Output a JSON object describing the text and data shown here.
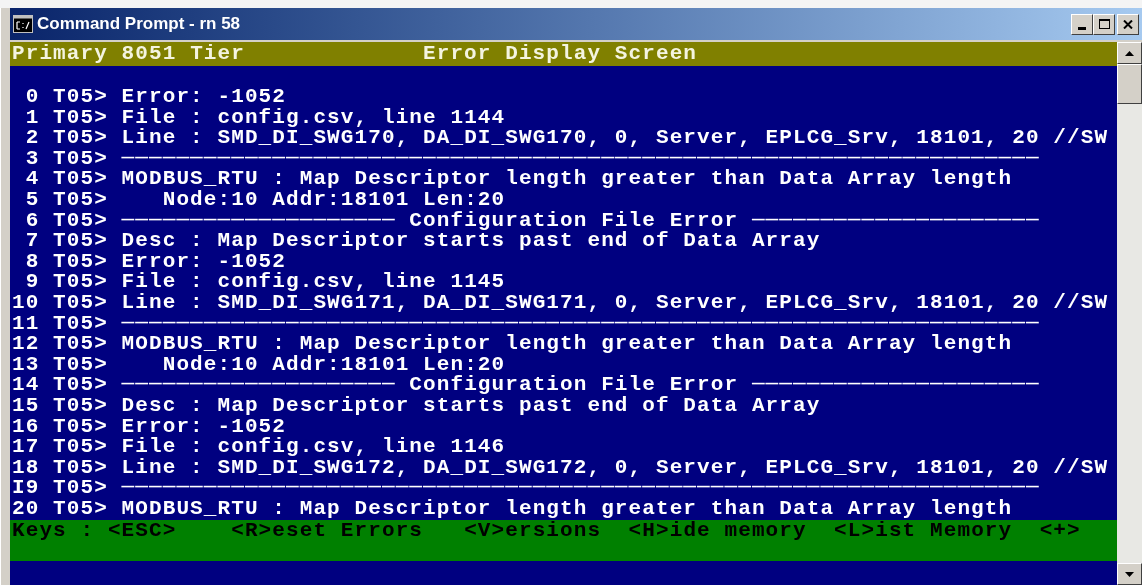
{
  "window": {
    "title": "Command Prompt - rn 58"
  },
  "header": {
    "left": "Primary 8051 Tier",
    "center": "Error Display Screen"
  },
  "lines": [
    {
      "num": "0",
      "text": "T05> Error: -1052"
    },
    {
      "num": "1",
      "text": "T05> File : config.csv, line 1144"
    },
    {
      "num": "2",
      "text": "T05> Line : SMD_DI_SWG170, DA_DI_SWG170, 0, Server, EPLCG_Srv, 18101, 20 //SW"
    },
    {
      "num": "3",
      "text": "T05> ───────────────────────────────────────────────────────────────────"
    },
    {
      "num": "4",
      "text": "T05> MODBUS_RTU : Map Descriptor length greater than Data Array length"
    },
    {
      "num": "5",
      "text": "T05>    Node:10 Addr:18101 Len:20"
    },
    {
      "num": "6",
      "text": "T05> ──────────────────── Configuration File Error ─────────────────────"
    },
    {
      "num": "7",
      "text": "T05> Desc : Map Descriptor starts past end of Data Array"
    },
    {
      "num": "8",
      "text": "T05> Error: -1052"
    },
    {
      "num": "9",
      "text": "T05> File : config.csv, line 1145"
    },
    {
      "num": "10",
      "text": "T05> Line : SMD_DI_SWG171, DA_DI_SWG171, 0, Server, EPLCG_Srv, 18101, 20 //SW"
    },
    {
      "num": "11",
      "text": "T05> ───────────────────────────────────────────────────────────────────"
    },
    {
      "num": "12",
      "text": "T05> MODBUS_RTU : Map Descriptor length greater than Data Array length"
    },
    {
      "num": "13",
      "text": "T05>    Node:10 Addr:18101 Len:20"
    },
    {
      "num": "14",
      "text": "T05> ──────────────────── Configuration File Error ─────────────────────"
    },
    {
      "num": "15",
      "text": "T05> Desc : Map Descriptor starts past end of Data Array"
    },
    {
      "num": "16",
      "text": "T05> Error: -1052"
    },
    {
      "num": "17",
      "text": "T05> File : config.csv, line 1146"
    },
    {
      "num": "18",
      "text": "T05> Line : SMD_DI_SWG172, DA_DI_SWG172, 0, Server, EPLCG_Srv, 18101, 20 //SW"
    },
    {
      "num": "I9",
      "text": "T05> ───────────────────────────────────────────────────────────────────"
    },
    {
      "num": "20",
      "text": "T05> MODBUS_RTU : Map Descriptor length greater than Data Array length"
    }
  ],
  "keys": {
    "label": "Keys :",
    "items": [
      "<ESC>",
      "<R>eset Errors",
      "<V>ersions",
      "<H>ide memory",
      "<L>ist Memory",
      "<+>"
    ]
  }
}
